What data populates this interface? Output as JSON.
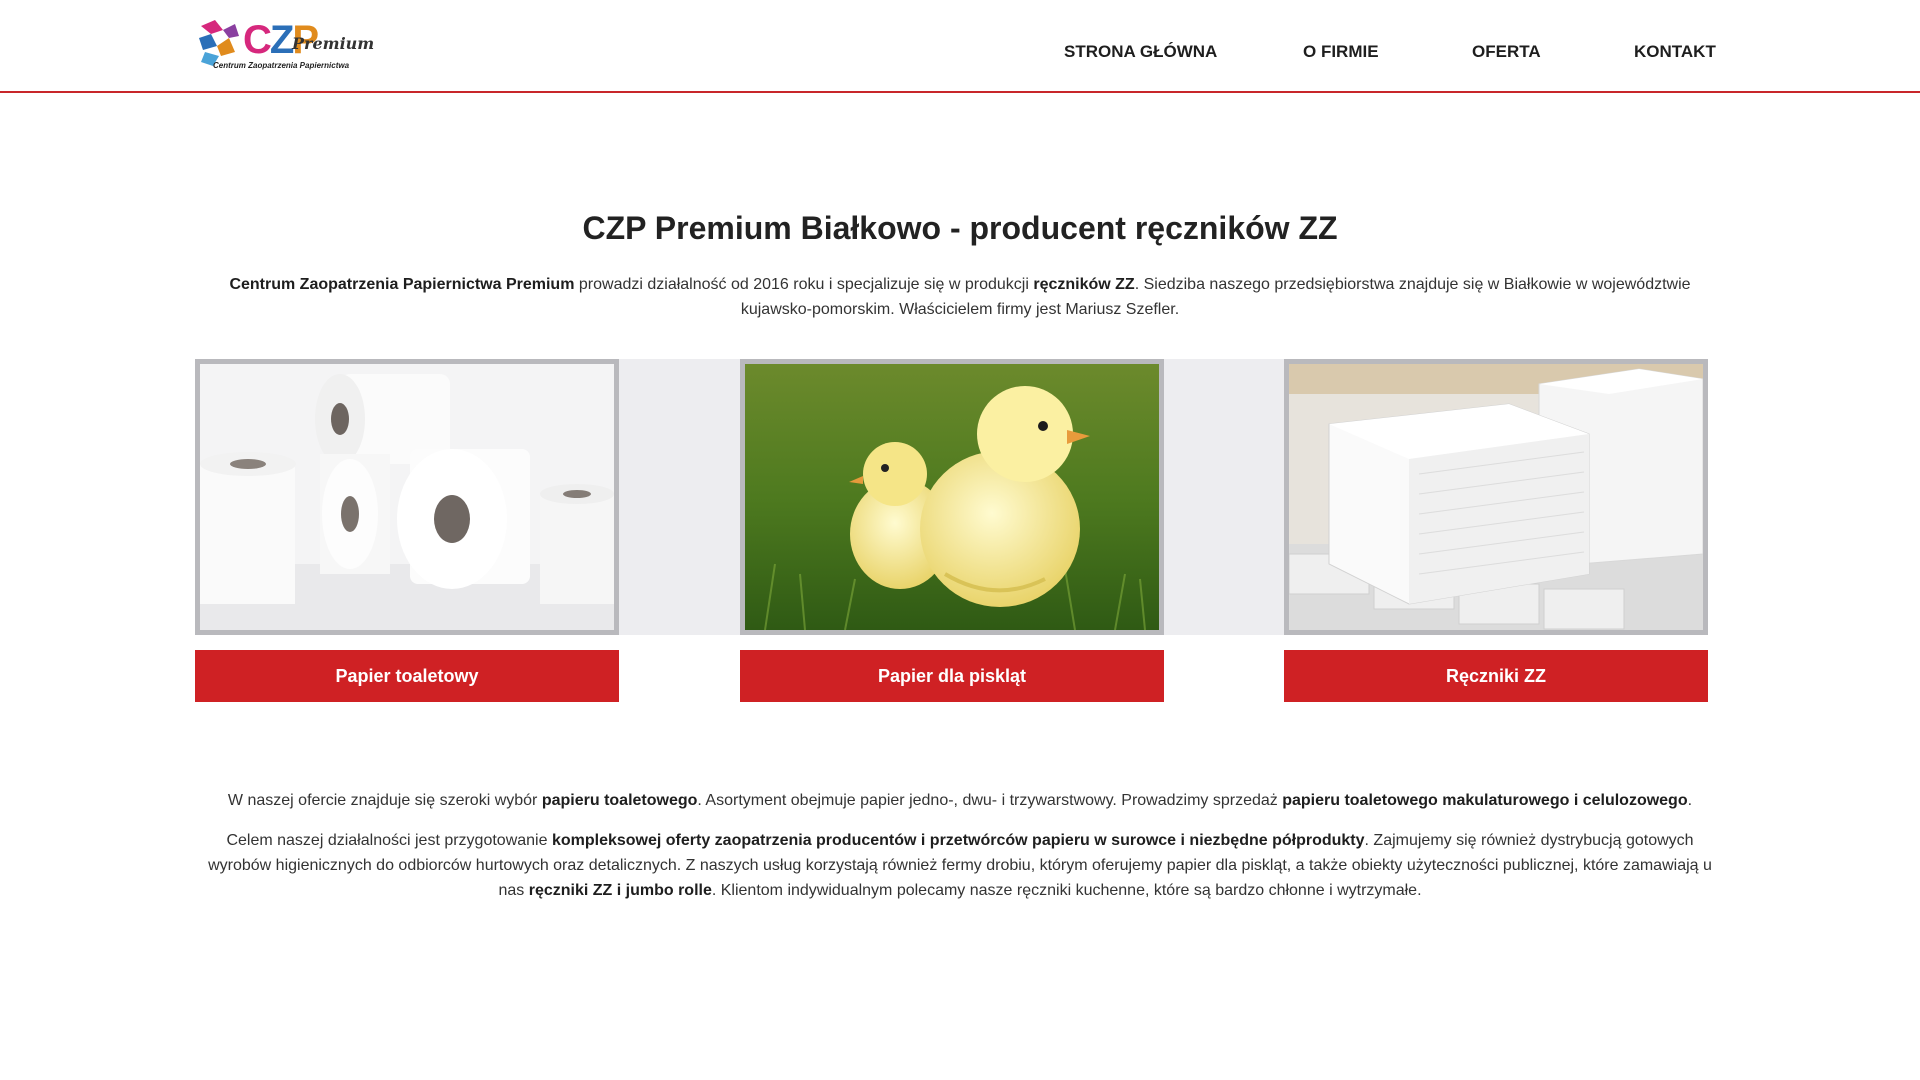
{
  "header": {
    "logo": {
      "letters": [
        "C",
        "Z",
        "P"
      ],
      "premium": "Premium",
      "tagline": "Centrum Zaopatrzenia Papiernictwa"
    },
    "nav": [
      {
        "label": "STRONA GŁÓWNA"
      },
      {
        "label": "O FIRMIE"
      },
      {
        "label": "OFERTA"
      },
      {
        "label": "KONTAKT"
      }
    ]
  },
  "main": {
    "title": "CZP Premium Białkowo - producent ręczników ZZ",
    "intro": {
      "company": "Centrum Zaopatrzenia Papiernictwa Premium",
      "text1": " prowadzi działalność od 2016 roku i specjalizuje się w produkcji ",
      "product": "ręczników ZZ",
      "text2": ". Siedziba naszego przedsiębiorstwa znajduje się w Białkowie w województwie kujawsko-pomorskim. Właścicielem firmy jest Mariusz Szefler."
    },
    "cards": [
      {
        "label": "Papier toaletowy",
        "icon": "toilet-paper-rolls-image"
      },
      {
        "label": "Papier dla piskląt",
        "icon": "chicks-image"
      },
      {
        "label": "Ręczniki ZZ",
        "icon": "zz-towels-image"
      }
    ],
    "para1": {
      "t1": "W naszej ofercie znajduje się szeroki wybór ",
      "b1": "papieru toaletowego",
      "t2": ". Asortyment obejmuje papier jedno-, dwu- i trzywarstwowy. Prowadzimy sprzedaż ",
      "b2": "papieru toaletowego makulaturowego i celulozowego",
      "t3": "."
    },
    "para2": {
      "t1": "Celem naszej działalności jest przygotowanie ",
      "b1": "kompleksowej oferty zaopatrzenia producentów i przetwórców papieru w surowce i niezbędne półprodukty",
      "t2": ". Zajmujemy się również dystrybucją gotowych wyrobów higienicznych do odbiorców hurtowych oraz detalicznych. Z naszych usług korzystają również fermy drobiu, którym oferujemy papier dla piskląt, a także obiekty użyteczności publicznej, które zamawiają u nas ",
      "b2": "ręczniki ZZ i jumbo rolle",
      "t3": ". Klientom indywidualnym polecamy nasze ręczniki kuchenne, które są bardzo chłonne i wytrzymałe."
    }
  },
  "colors": {
    "accent": "#cf2124",
    "header_line": "#c8262a",
    "band": "#ededf0",
    "frame": "#b9b9bd"
  }
}
